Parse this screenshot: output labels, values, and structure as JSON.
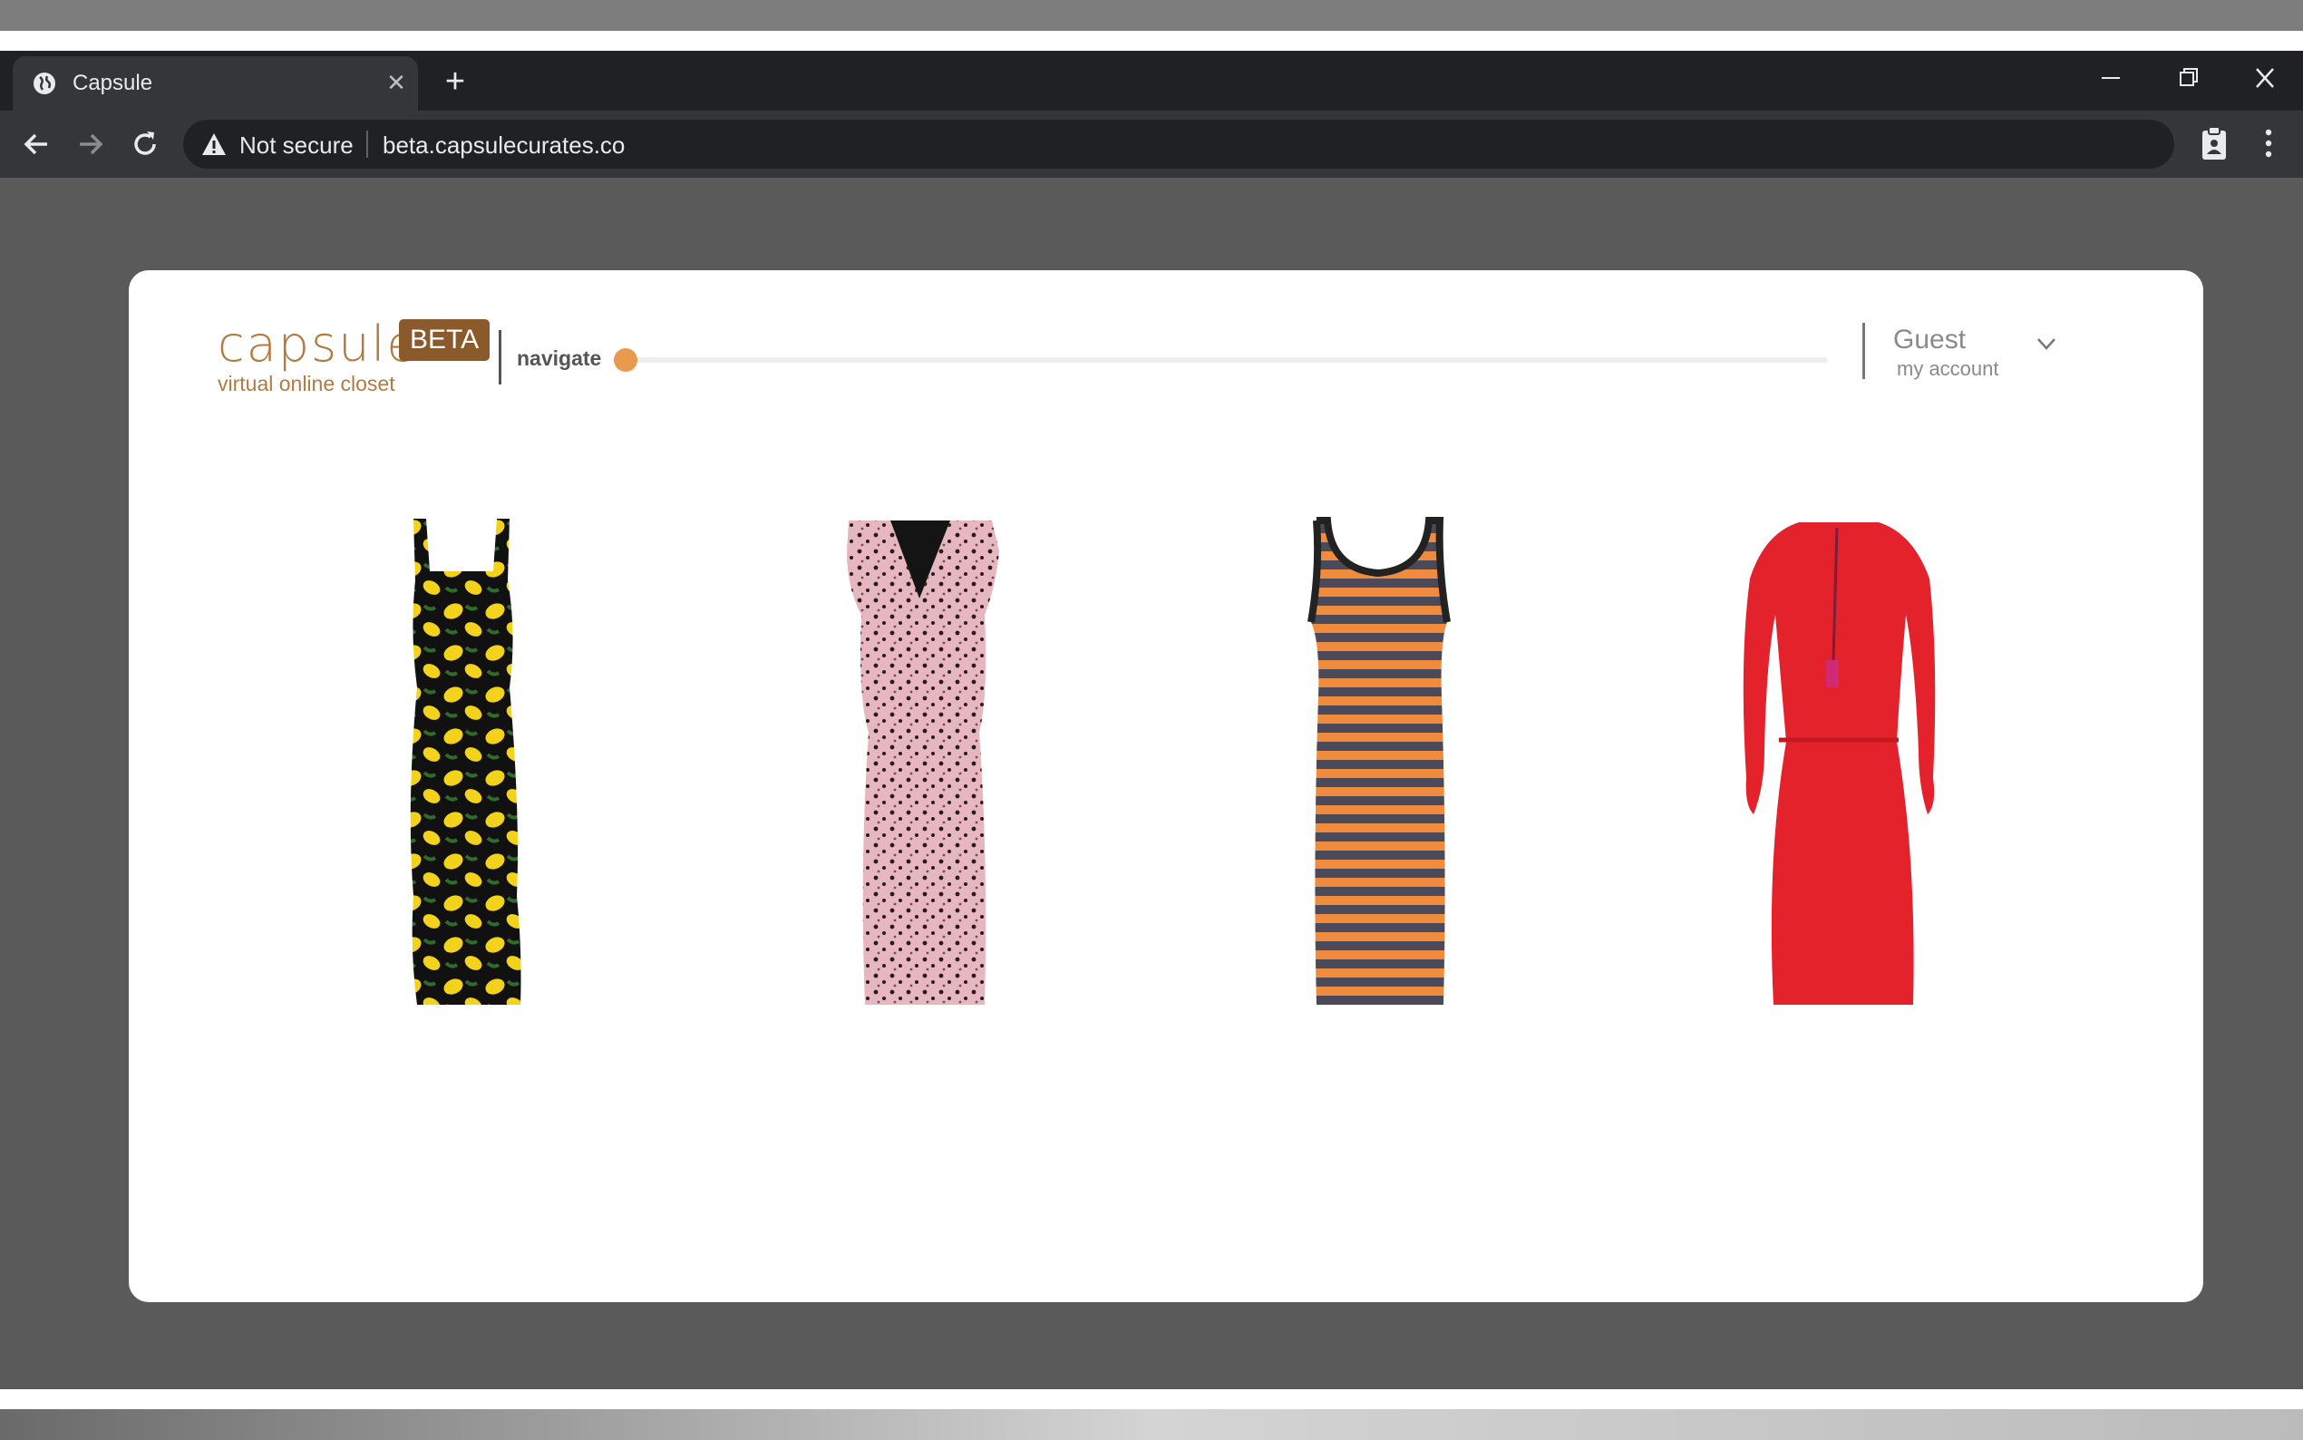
{
  "browser": {
    "tab_title": "Capsule",
    "security_label": "Not secure",
    "url": "beta.capsulecurates.co"
  },
  "site": {
    "logo_text": "capsule:",
    "beta_badge": "BETA",
    "tagline": "virtual online closet",
    "navigate_label": "navigate",
    "navigate_progress": 0.0,
    "account_name": "Guest",
    "account_link": "my account"
  },
  "products": [
    {
      "item": "lemon-print-dress",
      "colors": [
        "#111111",
        "#f2d21b",
        "#2f6b2a"
      ]
    },
    {
      "item": "pink-floral-v-neck-dress",
      "colors": [
        "#e6b7c0",
        "#2b1a1a"
      ]
    },
    {
      "item": "orange-striped-tank-dress",
      "colors": [
        "#f08a3c",
        "#4a4a5a"
      ]
    },
    {
      "item": "red-lace-midi-dress",
      "colors": [
        "#e3222c",
        "#c41920"
      ]
    }
  ],
  "colors": {
    "brand": "#b27a40",
    "badge": "#8b5a2b",
    "slider_knob": "#e99a4e"
  }
}
